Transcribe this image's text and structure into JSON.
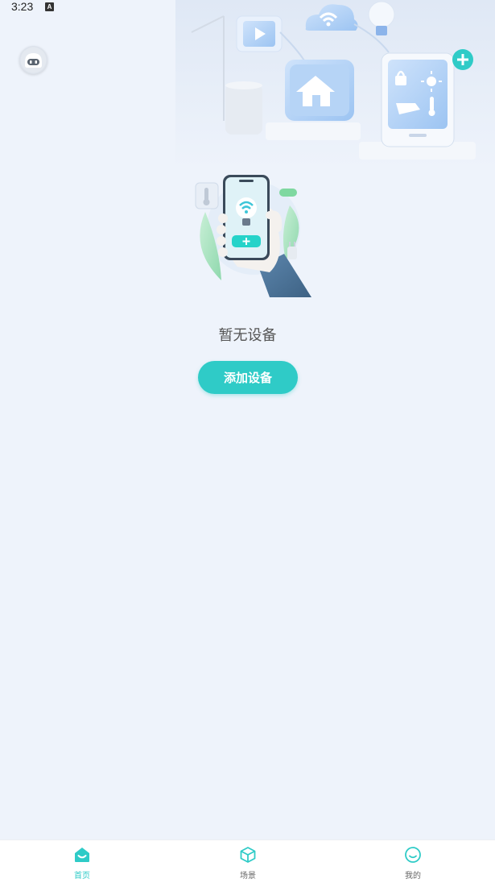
{
  "status_bar": {
    "time": "3:23",
    "notification_badge": "A"
  },
  "main": {
    "empty_state_text": "暂无设备",
    "add_device_label": "添加设备"
  },
  "tab_bar": {
    "items": [
      {
        "label": "首页",
        "icon": "home-icon",
        "active": true
      },
      {
        "label": "场景",
        "icon": "scene-cube-icon",
        "active": false
      },
      {
        "label": "我的",
        "icon": "profile-smile-icon",
        "active": false
      }
    ]
  },
  "colors": {
    "accent": "#2fcbc7",
    "inactive": "#666666",
    "background": "#eef3fb"
  }
}
